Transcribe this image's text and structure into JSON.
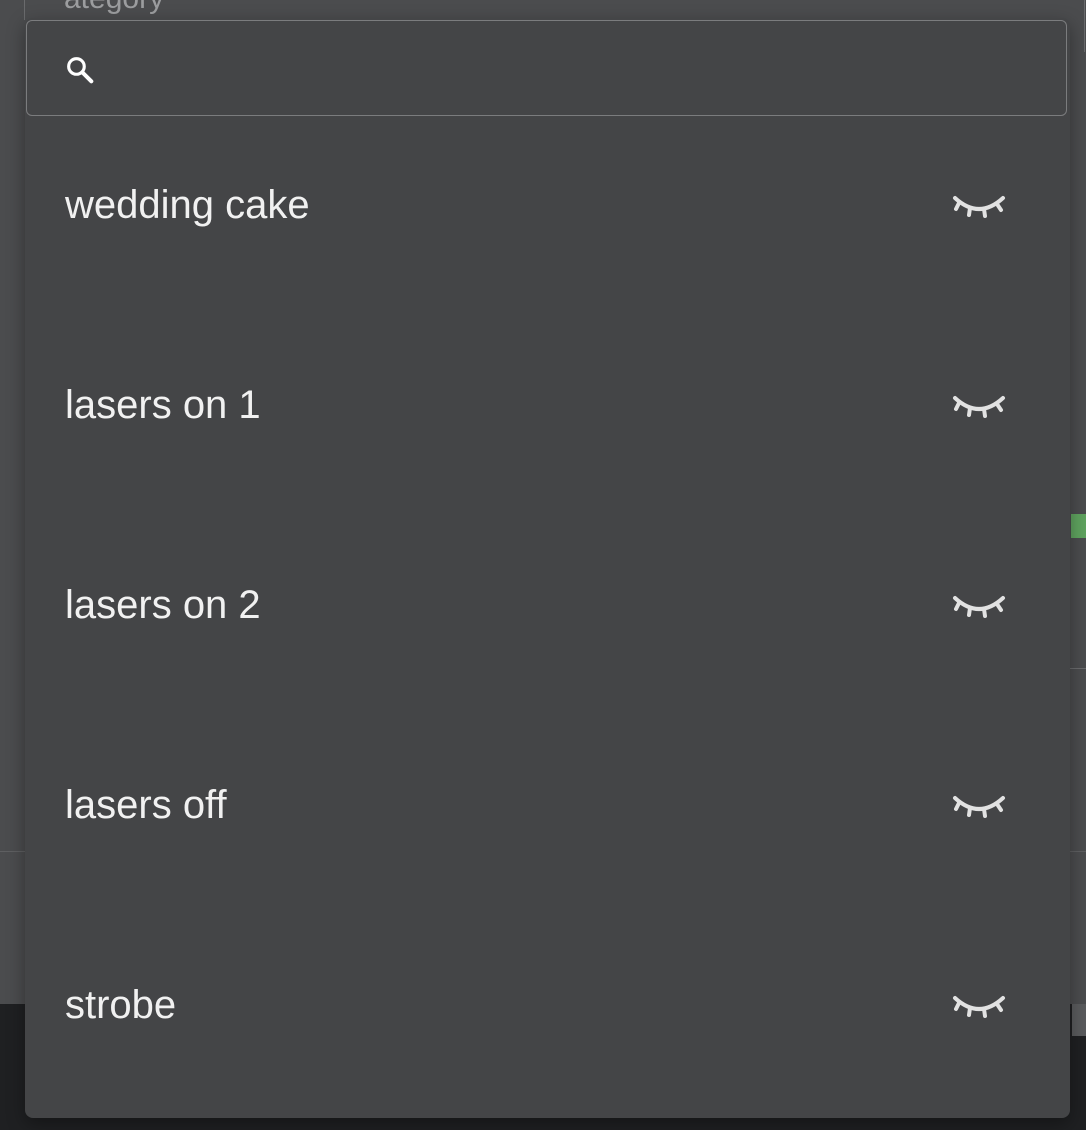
{
  "search": {
    "value": "",
    "placeholder": "",
    "icon": "search-icon"
  },
  "backdrop": {
    "partial_text": "ategory"
  },
  "items": [
    {
      "label": "wedding cake",
      "icon": "eye-closed-icon"
    },
    {
      "label": "lasers on 1",
      "icon": "eye-closed-icon"
    },
    {
      "label": "lasers on 2",
      "icon": "eye-closed-icon"
    },
    {
      "label": "lasers off",
      "icon": "eye-closed-icon"
    },
    {
      "label": "strobe",
      "icon": "eye-closed-icon"
    }
  ],
  "colors": {
    "panel_bg": "#444547",
    "text": "#f1f1f1",
    "icon": "#e2e2e2",
    "accent_green": "#5fa35f"
  }
}
